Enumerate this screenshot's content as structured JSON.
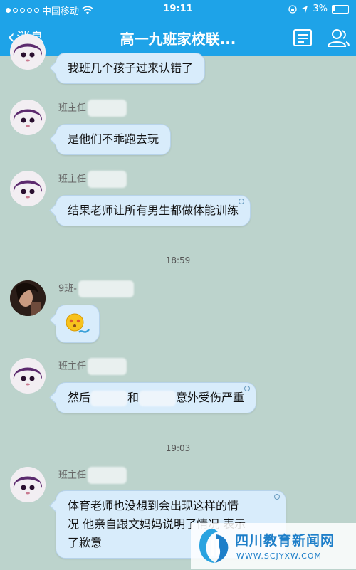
{
  "status_bar": {
    "carrier": "中国移动",
    "time": "19:11",
    "battery": "3%"
  },
  "nav": {
    "back_label": "消息",
    "title": "高一九班家校联..."
  },
  "messages": [
    {
      "text": "我班几个孩子过来认错了"
    },
    {
      "sender": "班主任",
      "text": "是他们不乖跑去玩"
    },
    {
      "sender": "班主任",
      "text": "结果老师让所有男生都做体能训练"
    },
    {
      "timestamp": "18:59"
    },
    {
      "sender": "9班-",
      "sticker": "blushing-face-sticker"
    },
    {
      "sender": "班主任",
      "text_parts": [
        "然后",
        "和",
        "意外受伤严重"
      ]
    },
    {
      "timestamp": "19:03"
    },
    {
      "sender": "班主任",
      "text_lines": [
        "体育老师也没想到会出现这样的情",
        "况 他亲自跟文妈妈说明了情况 表示",
        "了歉意"
      ]
    }
  ],
  "watermark": {
    "title": "四川教育新闻网",
    "url": "WWW.SCJYXW.COM"
  },
  "colors": {
    "header": "#1ea3e8",
    "chat_background": "#bcd3cc",
    "bubble": "#d8ecfb",
    "watermark_accent": "#1e7fc9"
  }
}
